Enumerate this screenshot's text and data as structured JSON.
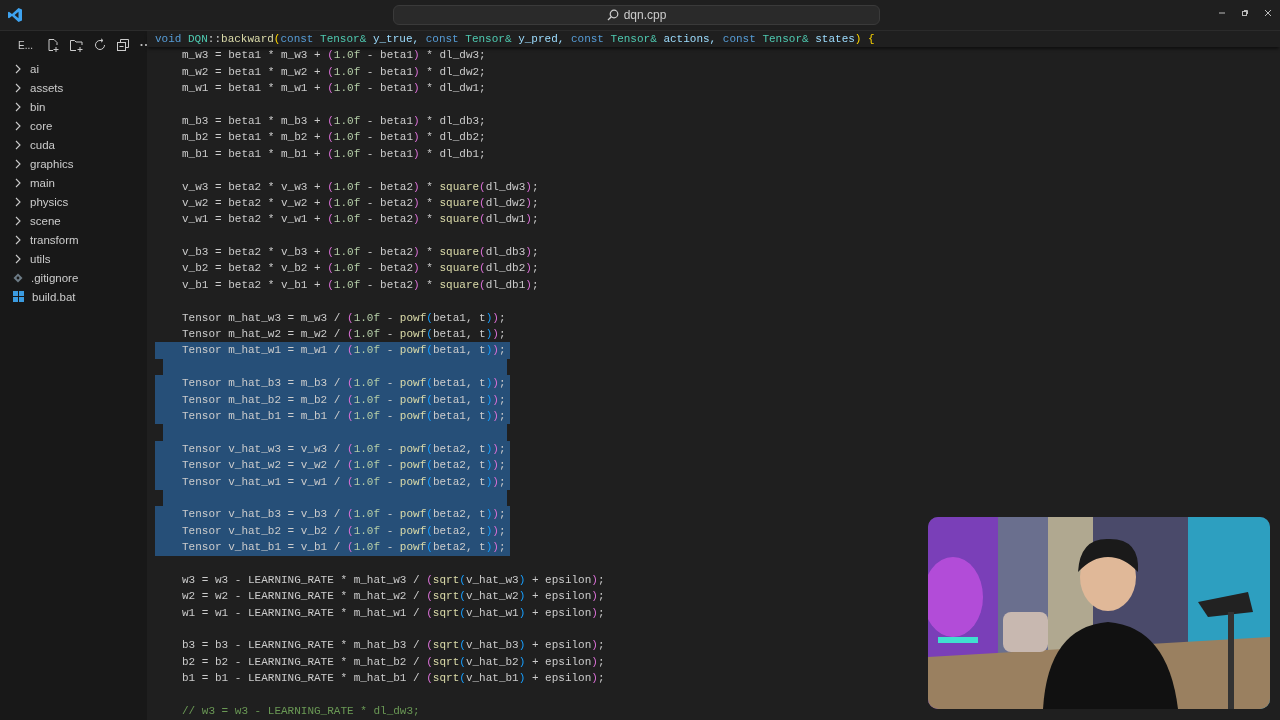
{
  "title_bar": {
    "search": {
      "value": "dqn.cpp"
    }
  },
  "explorer": {
    "title": "E...",
    "items": [
      {
        "label": "ai",
        "kind": "folder"
      },
      {
        "label": "assets",
        "kind": "folder"
      },
      {
        "label": "bin",
        "kind": "folder"
      },
      {
        "label": "core",
        "kind": "folder"
      },
      {
        "label": "cuda",
        "kind": "folder"
      },
      {
        "label": "graphics",
        "kind": "folder"
      },
      {
        "label": "main",
        "kind": "folder"
      },
      {
        "label": "physics",
        "kind": "folder"
      },
      {
        "label": "scene",
        "kind": "folder"
      },
      {
        "label": "transform",
        "kind": "folder"
      },
      {
        "label": "utils",
        "kind": "folder"
      },
      {
        "label": ".gitignore",
        "kind": "config"
      },
      {
        "label": "build.bat",
        "kind": "script"
      }
    ]
  },
  "editor": {
    "sticky_header": [
      {
        "text": "void ",
        "kind": "keyword"
      },
      {
        "text": "DQN",
        "kind": "type"
      },
      {
        "text": "::",
        "kind": "plain"
      },
      {
        "text": "backward",
        "kind": "function"
      },
      {
        "text": "(",
        "kind": "bracket"
      },
      {
        "text": "const ",
        "kind": "keyword"
      },
      {
        "text": "Tensor&",
        "kind": "type"
      },
      {
        "text": " y_true, ",
        "kind": "variable"
      },
      {
        "text": "const ",
        "kind": "keyword"
      },
      {
        "text": "Tensor&",
        "kind": "type"
      },
      {
        "text": " y_pred, ",
        "kind": "variable"
      },
      {
        "text": "const ",
        "kind": "keyword"
      },
      {
        "text": "Tensor&",
        "kind": "type"
      },
      {
        "text": " actions, ",
        "kind": "variable"
      },
      {
        "text": "const ",
        "kind": "keyword"
      },
      {
        "text": "Tensor&",
        "kind": "type"
      },
      {
        "text": " states",
        "kind": "variable"
      },
      {
        "text": ")",
        "kind": "bracket"
      },
      {
        "text": " {",
        "kind": "bracket"
      }
    ],
    "blocks": [
      {
        "lines": [
          {
            "text": "m_w3 = beta1 * m_w3 + (1.0f - beta1) * dl_dw3;",
            "selected": false
          },
          {
            "text": "m_w2 = beta1 * m_w2 + (1.0f - beta1) * dl_dw2;",
            "selected": false
          },
          {
            "text": "m_w1 = beta1 * m_w1 + (1.0f - beta1) * dl_dw1;",
            "selected": false
          }
        ]
      },
      {
        "lines": [
          {
            "text": "m_b3 = beta1 * m_b3 + (1.0f - beta1) * dl_db3;",
            "selected": false
          },
          {
            "text": "m_b2 = beta1 * m_b2 + (1.0f - beta1) * dl_db2;",
            "selected": false
          },
          {
            "text": "m_b1 = beta1 * m_b1 + (1.0f - beta1) * dl_db1;",
            "selected": false
          }
        ]
      },
      {
        "lines": [
          {
            "text": "v_w3 = beta2 * v_w3 + (1.0f - beta2) * square(dl_dw3);",
            "selected": false
          },
          {
            "text": "v_w2 = beta2 * v_w2 + (1.0f - beta2) * square(dl_dw2);",
            "selected": false
          },
          {
            "text": "v_w1 = beta2 * v_w1 + (1.0f - beta2) * square(dl_dw1);",
            "selected": false
          }
        ]
      },
      {
        "lines": [
          {
            "text": "v_b3 = beta2 * v_b3 + (1.0f - beta2) * square(dl_db3);",
            "selected": false
          },
          {
            "text": "v_b2 = beta2 * v_b2 + (1.0f - beta2) * square(dl_db2);",
            "selected": false
          },
          {
            "text": "v_b1 = beta2 * v_b1 + (1.0f - beta2) * square(dl_db1);",
            "selected": false
          }
        ]
      },
      {
        "lines": [
          {
            "text": "Tensor m_hat_w3 = m_w3 / (1.0f - powf(beta1, t));",
            "selected": false
          },
          {
            "text": "Tensor m_hat_w2 = m_w2 / (1.0f - powf(beta1, t));",
            "selected": false
          },
          {
            "text": "Tensor m_hat_w1 = m_w1 / (1.0f - powf(beta1, t));",
            "selected": true
          }
        ]
      },
      {
        "lines": [
          {
            "text": "Tensor m_hat_b3 = m_b3 / (1.0f - powf(beta1, t));",
            "selected": true
          },
          {
            "text": "Tensor m_hat_b2 = m_b2 / (1.0f - powf(beta1, t));",
            "selected": true
          },
          {
            "text": "Tensor m_hat_b1 = m_b1 / (1.0f - powf(beta1, t));",
            "selected": true
          }
        ]
      },
      {
        "lines": [
          {
            "text": "Tensor v_hat_w3 = v_w3 / (1.0f - powf(beta2, t));",
            "selected": true
          },
          {
            "text": "Tensor v_hat_w2 = v_w2 / (1.0f - powf(beta2, t));",
            "selected": true
          },
          {
            "text": "Tensor v_hat_w1 = v_w1 / (1.0f - powf(beta2, t));",
            "selected": true
          }
        ]
      },
      {
        "lines": [
          {
            "text": "Tensor v_hat_b3 = v_b3 / (1.0f - powf(beta2, t));",
            "selected": true
          },
          {
            "text": "Tensor v_hat_b2 = v_b2 / (1.0f - powf(beta2, t));",
            "selected": true
          },
          {
            "text": "Tensor v_hat_b1 = v_b1 / (1.0f - powf(beta2, t));",
            "selected": true
          }
        ]
      },
      {
        "lines": [
          {
            "text": "w3 = w3 - LEARNING_RATE * m_hat_w3 / (sqrt(v_hat_w3) + epsilon);",
            "selected": false
          },
          {
            "text": "w2 = w2 - LEARNING_RATE * m_hat_w2 / (sqrt(v_hat_w2) + epsilon);",
            "selected": false
          },
          {
            "text": "w1 = w1 - LEARNING_RATE * m_hat_w1 / (sqrt(v_hat_w1) + epsilon);",
            "selected": false
          }
        ]
      },
      {
        "lines": [
          {
            "text": "b3 = b3 - LEARNING_RATE * m_hat_b3 / (sqrt(v_hat_b3) + epsilon);",
            "selected": false
          },
          {
            "text": "b2 = b2 - LEARNING_RATE * m_hat_b2 / (sqrt(v_hat_b2) + epsilon);",
            "selected": false
          },
          {
            "text": "b1 = b1 - LEARNING_RATE * m_hat_b1 / (sqrt(v_hat_b1) + epsilon);",
            "selected": false
          }
        ]
      },
      {
        "lines": [
          {
            "text": "// w3 = w3 - LEARNING_RATE * dl_dw3;",
            "selected": false
          }
        ]
      }
    ]
  }
}
